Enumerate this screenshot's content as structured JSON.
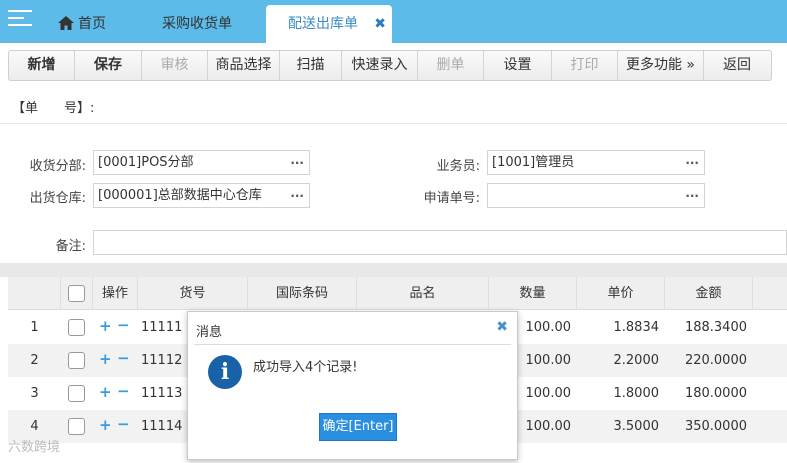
{
  "tabs": {
    "home": "首页",
    "purchase": "采购收货单",
    "active": "配送出库单",
    "close_glyph": "✖"
  },
  "toolbar": [
    {
      "label": "新增",
      "bold": true,
      "disabled": false
    },
    {
      "label": "保存",
      "bold": true,
      "disabled": false
    },
    {
      "label": "审核",
      "bold": false,
      "disabled": true
    },
    {
      "label": "商品选择",
      "bold": false,
      "disabled": false
    },
    {
      "label": "扫描",
      "bold": false,
      "disabled": false
    },
    {
      "label": "快速录入",
      "bold": false,
      "disabled": false
    },
    {
      "label": "删单",
      "bold": false,
      "disabled": true
    },
    {
      "label": "设置",
      "bold": false,
      "disabled": false
    },
    {
      "label": "打印",
      "bold": false,
      "disabled": true
    },
    {
      "label": "更多功能 »",
      "bold": false,
      "disabled": false
    },
    {
      "label": "返回",
      "bold": false,
      "disabled": false
    }
  ],
  "form": {
    "order_no_label": "【单　　号】:",
    "receive_branch_label": "收货分部:",
    "receive_branch_value": "[0001]POS分部",
    "warehouse_label": "出货仓库:",
    "warehouse_value": "[000001]总部数据中心仓库",
    "salesman_label": "业务员:",
    "salesman_value": "[1001]管理员",
    "request_no_label": "申请单号:",
    "request_no_value": "",
    "remark_label": "备注:",
    "remark_value": "",
    "dots": "..."
  },
  "grid": {
    "headers": [
      "操作",
      "货号",
      "国际条码",
      "品名",
      "数量",
      "单价",
      "金额"
    ],
    "rows": [
      {
        "idx": "1",
        "code": "11111",
        "qty": "100.00",
        "price": "1.8834",
        "amount": "188.3400"
      },
      {
        "idx": "2",
        "code": "11112",
        "qty": "100.00",
        "price": "2.2000",
        "amount": "220.0000"
      },
      {
        "idx": "3",
        "code": "11113",
        "qty": "100.00",
        "price": "1.8000",
        "amount": "180.0000"
      },
      {
        "idx": "4",
        "code": "11114",
        "qty": "100.00",
        "price": "3.5000",
        "amount": "350.0000"
      }
    ]
  },
  "modal": {
    "title": "消息",
    "close": "✖",
    "icon_glyph": "i",
    "message": "成功导入4个记录!",
    "ok_label": "确定[Enter]"
  },
  "watermark": "六数跨境"
}
